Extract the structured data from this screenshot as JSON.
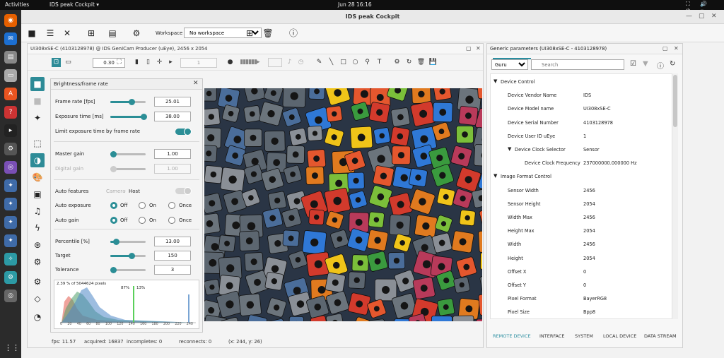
{
  "topbar": {
    "activities": "Activities",
    "app": "IDS peak Cockpit ▾",
    "clock": "Jun 28  16:16",
    "tray": "⛶ 🔊 ⏻ ▾"
  },
  "window": {
    "title": "IDS peak Cockpit"
  },
  "toolbar": {
    "workspace_label": "Workspace",
    "workspace_value": "No workspace"
  },
  "camera": {
    "title": "UI308xSE-C (4103128978) @ IDS GenICam Producer (uEye), 2456 x 2054",
    "zoom": "0.30",
    "frame": "1",
    "status": {
      "fps": "fps: 11.57",
      "acquired": "acquired: 16837",
      "incompletes": "incompletes: 0",
      "reconnects": "reconnects: 0",
      "coords": "(x: 244, y: 26)"
    }
  },
  "brightness": {
    "title": "Brightness/frame rate",
    "frame_rate_label": "Frame rate [fps]",
    "frame_rate": "25.01",
    "exposure_label": "Exposure time [ms]",
    "exposure": "38.00",
    "limit_label": "Limit exposure time by frame rate",
    "master_gain_label": "Master gain",
    "master_gain": "1.00",
    "digital_gain_label": "Digital gain",
    "digital_gain": "1.00",
    "auto_features_label": "Auto features",
    "camera_label": "Camera",
    "dot": "·",
    "host_label": "Host",
    "auto_exposure_label": "Auto exposure",
    "auto_gain_label": "Auto gain",
    "off": "Off",
    "on": "On",
    "once": "Once",
    "percentile_label": "Percentile [%]",
    "percentile": "13.00",
    "target_label": "Target",
    "target": "150",
    "tolerance_label": "Tolerance",
    "tolerance": "3",
    "histo_info": "2.39 % of 5044624 pixels",
    "histo_p1": "87%",
    "histo_p2": "13%",
    "histo_ticks": [
      "0",
      "20",
      "40",
      "60",
      "80",
      "100",
      "120",
      "140",
      "160",
      "180",
      "200",
      "220",
      "240"
    ]
  },
  "params": {
    "title": "Generic parameters (UI308xSE-C - 4103128978)",
    "visibility": "Guru",
    "search_placeholder": "Search",
    "rows": [
      {
        "name": "Device Control",
        "value": "",
        "level": 0,
        "group": true
      },
      {
        "name": "Device Vendor Name",
        "value": "IDS",
        "level": 2
      },
      {
        "name": "Device Model name",
        "value": "UI308xSE-C",
        "level": 2
      },
      {
        "name": "Device Serial Number",
        "value": "4103128978",
        "level": 2
      },
      {
        "name": "Device User ID uEye",
        "value": "1",
        "level": 2
      },
      {
        "name": "Device Clock Selector",
        "value": "Sensor",
        "level": 1,
        "group": true
      },
      {
        "name": "Device Clock Frequency",
        "value": "237000000.000000 Hz",
        "level": 3
      },
      {
        "name": "Image Format Control",
        "value": "",
        "level": 0,
        "group": true
      },
      {
        "name": "Sensor Width",
        "value": "2456",
        "level": 2
      },
      {
        "name": "Sensor Height",
        "value": "2054",
        "level": 2
      },
      {
        "name": "Width Max",
        "value": "2456",
        "level": 2
      },
      {
        "name": "Height Max",
        "value": "2054",
        "level": 2
      },
      {
        "name": "Width",
        "value": "2456",
        "level": 2
      },
      {
        "name": "Height",
        "value": "2054",
        "level": 2
      },
      {
        "name": "Offset X",
        "value": "0",
        "level": 2
      },
      {
        "name": "Offset Y",
        "value": "0",
        "level": 2
      },
      {
        "name": "Pixel Format",
        "value": "BayerRG8",
        "level": 2
      },
      {
        "name": "Pixel Size",
        "value": "Bpp8",
        "level": 2
      }
    ],
    "tabs": [
      "REMOTE DEVICE",
      "INTERFACE",
      "SYSTEM",
      "LOCAL DEVICE",
      "DATA STREAM"
    ]
  }
}
